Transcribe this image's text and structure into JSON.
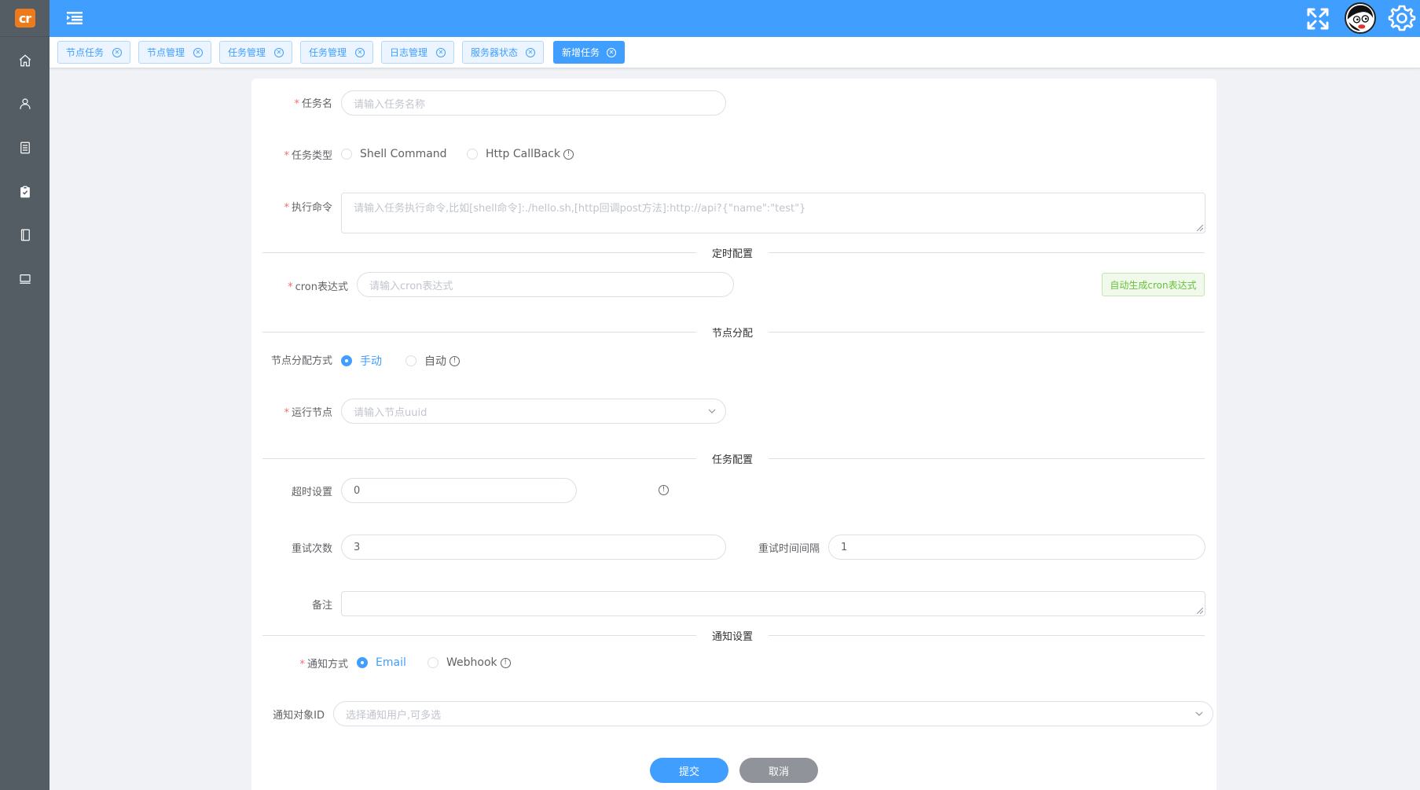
{
  "logo": {
    "text": "cr"
  },
  "colors": {
    "header": "#409eff",
    "sidebar": "#545c64",
    "logo": "#ee7b1b",
    "required": "#f56c6c",
    "success": "#67c23a",
    "info_button": "#909399"
  },
  "sidebar": {
    "items": [
      {
        "icon": "home-icon"
      },
      {
        "icon": "user-icon"
      },
      {
        "icon": "document-icon"
      },
      {
        "icon": "clipboard-check-icon"
      },
      {
        "icon": "notebook-icon"
      },
      {
        "icon": "monitor-icon"
      }
    ]
  },
  "header": {
    "menu_icon": "menu-fold-icon",
    "fullscreen_icon": "fullscreen-icon",
    "settings_icon": "gear-icon"
  },
  "tags": [
    {
      "label": "节点任务",
      "active": false
    },
    {
      "label": "节点管理",
      "active": false
    },
    {
      "label": "任务管理",
      "active": false
    },
    {
      "label": "任务管理",
      "active": false
    },
    {
      "label": "日志管理",
      "active": false
    },
    {
      "label": "服务器状态",
      "active": false
    },
    {
      "label": "新增任务",
      "active": true
    }
  ],
  "form": {
    "task_name": {
      "label": "任务名",
      "placeholder": "请输入任务名称"
    },
    "task_type": {
      "label": "任务类型",
      "options": [
        "Shell Command",
        "Http CallBack"
      ]
    },
    "command": {
      "label": "执行命令",
      "placeholder": "请输入任务执行命令,比如[shell命令]:./hello.sh,[http回调post方法]:http://api?{\"name\":\"test\"}"
    },
    "section_timer": "定时配置",
    "cron": {
      "label": "cron表达式",
      "placeholder": "请输入cron表达式",
      "auto_button": "自动生成cron表达式"
    },
    "section_node": "节点分配",
    "node_mode": {
      "label": "节点分配方式",
      "options": [
        "手动",
        "自动"
      ],
      "selected": "手动"
    },
    "run_node": {
      "label": "运行节点",
      "placeholder": "请输入节点uuid"
    },
    "section_task": "任务配置",
    "timeout": {
      "label": "超时设置",
      "value": "0"
    },
    "retry_count": {
      "label": "重试次数",
      "value": "3"
    },
    "retry_interval": {
      "label": "重试时间间隔",
      "value": "1"
    },
    "remark": {
      "label": "备注"
    },
    "section_notify": "通知设置",
    "notify_mode": {
      "label": "通知方式",
      "options": [
        "Email",
        "Webhook"
      ],
      "selected": "Email"
    },
    "notify_target": {
      "label": "通知对象ID",
      "placeholder": "选择通知用户,可多选"
    },
    "submit": "提交",
    "cancel": "取消"
  }
}
